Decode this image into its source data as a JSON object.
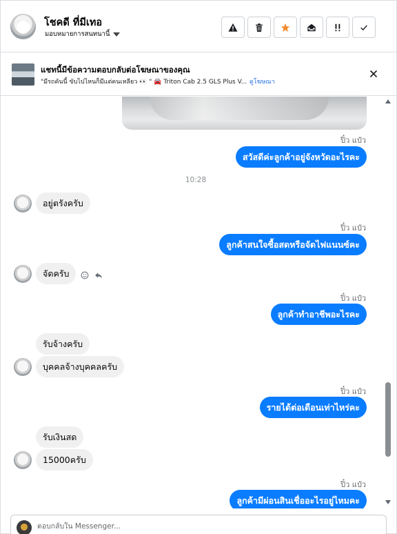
{
  "header": {
    "contact_name": "โชคดี ที่มีเทอ",
    "assign_label": "มอบหมายการสนทนานี้",
    "toolbar": [
      {
        "name": "report-spam-button",
        "icon": "warning-icon"
      },
      {
        "name": "delete-button",
        "icon": "trash-icon"
      },
      {
        "name": "star-button",
        "icon": "star-icon"
      },
      {
        "name": "mark-unread-button",
        "icon": "envelope-open-icon"
      },
      {
        "name": "follow-up-button",
        "icon": "flag-icon"
      },
      {
        "name": "mark-done-button",
        "icon": "check-icon"
      }
    ],
    "star_color": "#f28b2f"
  },
  "ad_banner": {
    "title": "แชทนี้มีข้อความตอบกลับต่อโฆษณาของคุณ",
    "subtitle": "\"มีรถคันนี้ ขับไปไหนก็มีแต่คนเหลียว 👀 \" 🚘 Triton Cab 2.5 GLS Plus V...",
    "view_ad_link": "ดูโฆษณา"
  },
  "messages": [
    {
      "type": "out",
      "sender": "ปิ๋ว แป๋ว",
      "text": "สวัสดีค่ะลูกค้าอยู่จังหวัดอะไรคะ"
    },
    {
      "type": "time",
      "text": "10:28"
    },
    {
      "type": "in",
      "text": "อยู่ตรังครับ"
    },
    {
      "type": "out",
      "sender": "ปิ๋ว แป๋ว",
      "text": "ลูกค้าสนใจซื้อสดหรือจัดไฟแนนซ์คะ"
    },
    {
      "type": "in",
      "text": "จัดครับ"
    },
    {
      "type": "out",
      "sender": "ปิ๋ว แป๋ว",
      "text": "ลูกค้าทำอาชีพอะไรคะ"
    },
    {
      "type": "in",
      "text": "รับจ้างครับ"
    },
    {
      "type": "in",
      "text": "บุคคลจ้างบุคคลครับ"
    },
    {
      "type": "out",
      "sender": "ปิ๋ว แป๋ว",
      "text": "รายได้ต่อเดือนเท่าไหร่คะ"
    },
    {
      "type": "in",
      "text": "รับเงินสด"
    },
    {
      "type": "in",
      "text": "15000ครับ"
    },
    {
      "type": "out",
      "sender": "ปิ๋ว แป๋ว",
      "text": "ลูกค้ามีผ่อนสินเชื่ออะไรอยู่ไหมคะ"
    }
  ],
  "reply": {
    "placeholder": "ตอบกลับใน Messenger..."
  },
  "colors": {
    "outgoing_bubble": "#0a7cff",
    "incoming_bubble": "#f0f0f0",
    "link": "#216fdb"
  }
}
